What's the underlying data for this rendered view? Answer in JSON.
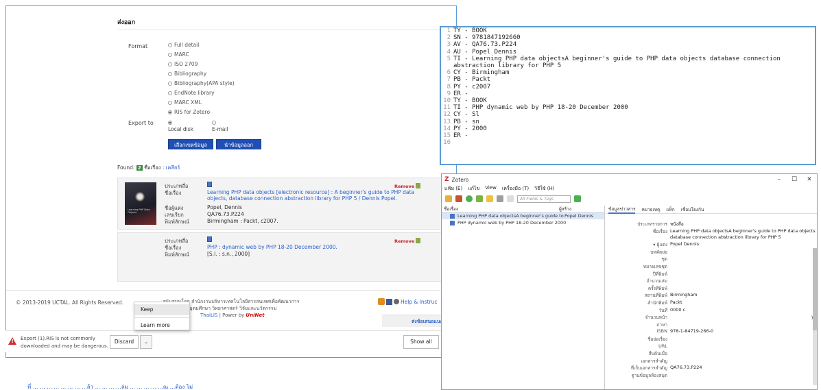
{
  "export": {
    "title": "ส่งออก",
    "format_label": "Format",
    "formats": [
      "Full detail",
      "MARC",
      "ISO 2709",
      "Bibliography",
      "Bibliography(APA style)",
      "EndNote library",
      "MARC XML",
      "RIS for Zotero"
    ],
    "selected_format": "RIS for Zotero",
    "export_to_label": "Export to",
    "export_to_options": [
      "Local disk",
      "E-mail"
    ],
    "selected_export_to": "Local disk",
    "select_all_button": "เลือกเขตข้อมูล",
    "export_button": "นำข้อมูลออก"
  },
  "results": {
    "found_prefix": "Found:",
    "found_count": "2",
    "found_suffix": "ชื่อเรื่อง :",
    "clear_link": "เคลียร์",
    "remove_label": "Remove",
    "labels": {
      "type": "ประเภทสื่อ",
      "title": "ชื่อเรื่อง",
      "author": "ชื่อผู้แต่ง",
      "call_no": "เลขเรียก",
      "publication": "พิมพ์ลักษณ์"
    },
    "items": [
      {
        "title": "Learning PHP data objects [electronic resource] : A beginner's guide to PHP data objects, database connection abstraction library for PHP 5 / Dennis Popel.",
        "author": "Popel, Dennis",
        "call_no": "QA76.73.P224",
        "publication": "Birmingham : Packt, c2007.",
        "thumb_text": "Learning PHP Data Objects"
      },
      {
        "title": "PHP : dynamic web by PHP 18-20 December 2000.",
        "publication": "[S.l. : s.n., 2000]"
      }
    ]
  },
  "footer": {
    "copyright": "© 2013-2019 UCTAL. All Rights Reserved.",
    "support_line1": "สนับสนุนโดย สำนักงานบริหารเทคโนโลยีสารสนเทศเพื่อพัฒนาการ",
    "support_line2": "กระทรวงการอุดมศึกษา วิทยาศาสตร์ วิจัยและนวัตกรรม",
    "support_line3a": "ThaiLIS",
    "support_line3b": "| Power by",
    "support_line3c": "UniNet",
    "help_text": "Help & Instruc",
    "suggest_text": "ส่งข้อเสนอแนะ/ปัญห"
  },
  "download_menu": {
    "items": [
      "Keep",
      "Learn more"
    ]
  },
  "download_bar": {
    "message_line1": "Export (1).RIS is not commonly",
    "message_line2": "downloaded and may be dangerous.",
    "discard": "Discard",
    "show_all": "Show all"
  },
  "bottom_note": "ที่ ... ... ... ... ... ... ... ...ล้ว ... ... ... ...ล่ม ... ... ... ... ...ณ ...ต้อง ไม่",
  "code": {
    "lines": [
      {
        "n": "1",
        "t": "TY - BOOK"
      },
      {
        "n": "2",
        "t": "SN - 9781847192660"
      },
      {
        "n": "3",
        "t": "AV - QA76.73.P224"
      },
      {
        "n": "4",
        "t": "AU - Popel Dennis"
      },
      {
        "n": "5",
        "t": "TI - Learning PHP data objectsA beginner's guide to PHP data objects database connection abstraction library for PHP 5"
      },
      {
        "n": "6",
        "t": "CY - Birmingham"
      },
      {
        "n": "7",
        "t": "PB - Packt"
      },
      {
        "n": "8",
        "t": "PY - c2007"
      },
      {
        "n": "9",
        "t": "ER -"
      },
      {
        "n": "10",
        "t": "TY - BOOK"
      },
      {
        "n": "11",
        "t": "TI - PHP dynamic web by PHP 18-20 December 2000"
      },
      {
        "n": "12",
        "t": "CY - Sl"
      },
      {
        "n": "13",
        "t": "PB - sn"
      },
      {
        "n": "14",
        "t": "PY - 2000"
      },
      {
        "n": "15",
        "t": "ER -"
      },
      {
        "n": "16",
        "t": ""
      }
    ]
  },
  "zotero": {
    "title": "Zotero",
    "menus": [
      "แฟ้ม (E)",
      "แก้ไข",
      "View",
      "เครื่องมือ (T)",
      "วิธีใช้ (H)"
    ],
    "search_placeholder": "All Fields & Tags",
    "col_title": "ชื่อเรื่อง",
    "col_creator": "ผู้สร้าง",
    "items": [
      {
        "title": "Learning PHP data objectsA beginner's guide to P...",
        "creator": "Popel Dennis",
        "selected": true
      },
      {
        "title": "PHP dynamic web by PHP 18-20 December 2000",
        "creator": "",
        "selected": false
      }
    ],
    "tabs": [
      "ข้อมูลข่าวสาร",
      "หมายเหตุ",
      "แท็ก",
      "เชื่อมโยงกัน"
    ],
    "fields": [
      {
        "label": "ประเภทรายการ",
        "value": "หนังสือ"
      },
      {
        "label": "ชื่อเรื่อง",
        "value": "Learning PHP data objectsA beginner's guide to PHP data objects"
      },
      {
        "label": "",
        "value": "database connection abstraction library for PHP 5"
      },
      {
        "label": "▾ ผู้แต่ง",
        "value": "Popel Dennis"
      },
      {
        "label": "บทคัดย่อ",
        "value": ""
      },
      {
        "label": "ชุด",
        "value": ""
      },
      {
        "label": "หมายเลขชุด",
        "value": ""
      },
      {
        "label": "ปีที่พิมพ์",
        "value": ""
      },
      {
        "label": "จำนวนเล่ม",
        "value": ""
      },
      {
        "label": "ครั้งที่พิมพ์",
        "value": ""
      },
      {
        "label": "สถานที่พิมพ์",
        "value": "Birmingham"
      },
      {
        "label": "สำนักพิมพ์",
        "value": "Packt"
      },
      {
        "label": "วันที่",
        "value": "0000 c"
      },
      {
        "label": "จำนวนหน้า",
        "value": ""
      },
      {
        "label": "ภาษา",
        "value": ""
      },
      {
        "label": "ISBN",
        "value": "978-1-84719-266-0"
      },
      {
        "label": "ชื่อย่อเรื่อง",
        "value": ""
      },
      {
        "label": "URL",
        "value": ""
      },
      {
        "label": "สืบค้นเมื่อ",
        "value": ""
      },
      {
        "label": "เอกสารสำคัญ",
        "value": ""
      },
      {
        "label": "ที่เก็บเอกสารสำคัญ",
        "value": "QA76.73.P224"
      },
      {
        "label": "ฐานข้อมูลห้องสมุด",
        "value": ""
      }
    ],
    "date_suffix": "y"
  }
}
